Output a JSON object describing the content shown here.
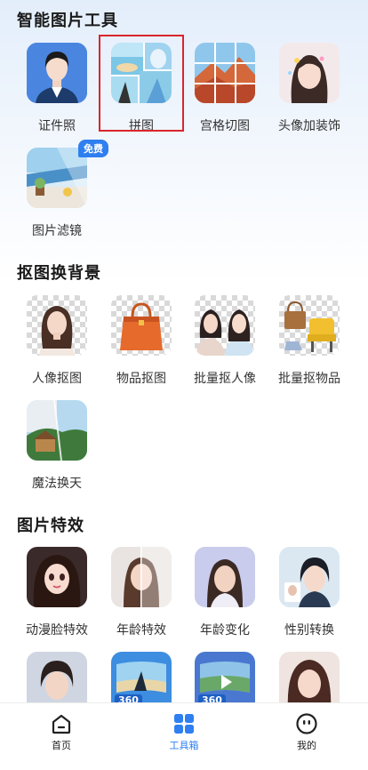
{
  "sections": [
    {
      "title": "智能图片工具"
    },
    {
      "title": "抠图换背景"
    },
    {
      "title": "图片特效"
    }
  ],
  "tools": {
    "id_photo": "证件照",
    "collage": "拼图",
    "grid_cut": "宫格切图",
    "avatar_decor": "头像加装饰",
    "photo_filter": "图片滤镜",
    "portrait_cutout": "人像抠图",
    "object_cutout": "物品抠图",
    "batch_portrait": "批量抠人像",
    "batch_object": "批量抠物品",
    "magic_sky": "魔法换天",
    "anime_face": "动漫脸特效",
    "age_effect": "年龄特效",
    "age_change": "年龄变化",
    "gender_swap": "性别转换"
  },
  "badges": {
    "free": "免费",
    "pano": "360"
  },
  "tabbar": {
    "home": "首页",
    "toolbox": "工具箱",
    "mine": "我的",
    "active": "toolbox"
  },
  "colors": {
    "accent": "#2f7ff0",
    "highlight": "#d9252b"
  }
}
